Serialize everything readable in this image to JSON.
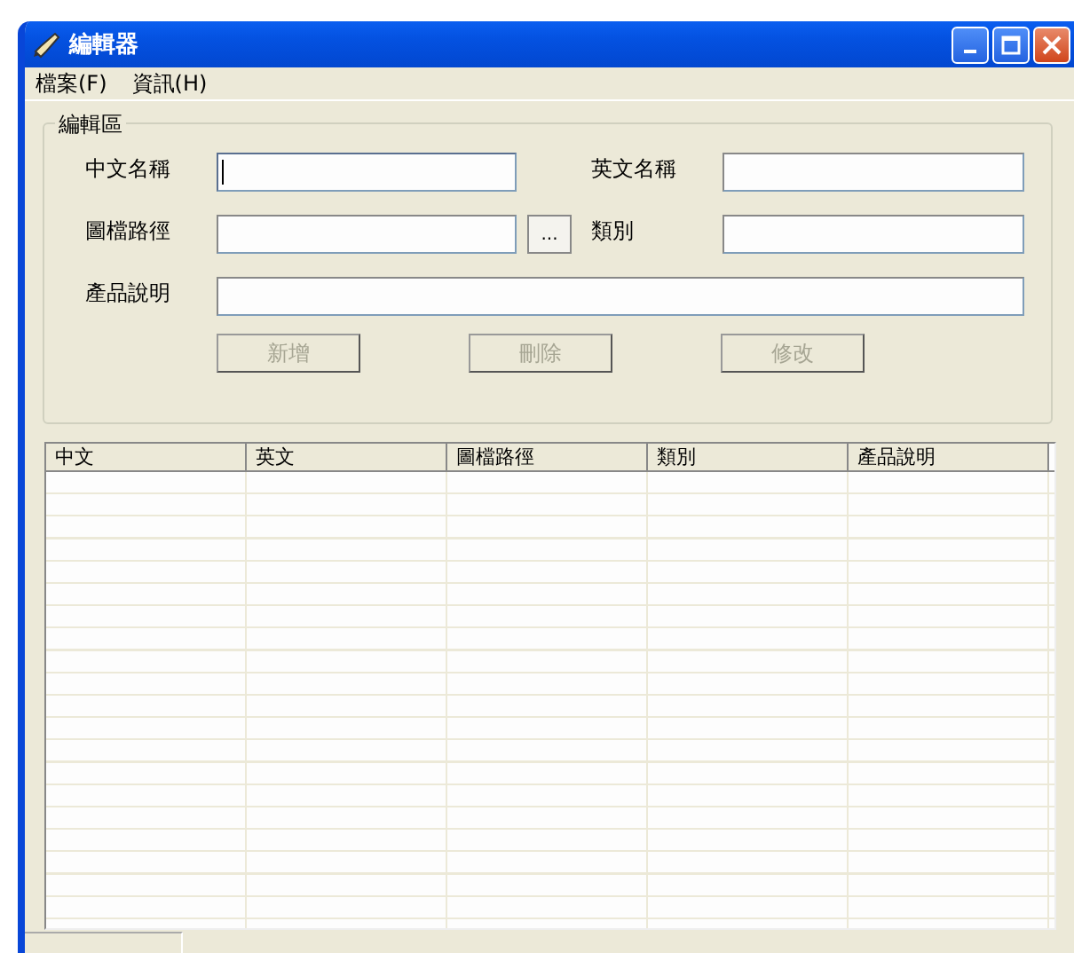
{
  "window": {
    "title": "編輯器"
  },
  "menu": [
    {
      "label": "檔案(F)"
    },
    {
      "label": "資訊(H)"
    }
  ],
  "editor_group": {
    "title": "編輯區",
    "fields": [
      {
        "label": "中文名稱",
        "focused": true
      },
      {
        "label": "英文名稱",
        "focused": false
      },
      {
        "label": "圖檔路徑",
        "focused": false,
        "browse_button": "..."
      },
      {
        "label": "類別",
        "focused": false
      },
      {
        "label": "產品說明",
        "focused": false
      }
    ],
    "buttons": [
      {
        "label": "新增",
        "disabled": true
      },
      {
        "label": "刪除",
        "disabled": true
      },
      {
        "label": "修改",
        "disabled": true
      }
    ]
  },
  "table": {
    "columns": [
      "中文",
      "英文",
      "圖檔路徑",
      "類別",
      "產品說明"
    ]
  }
}
